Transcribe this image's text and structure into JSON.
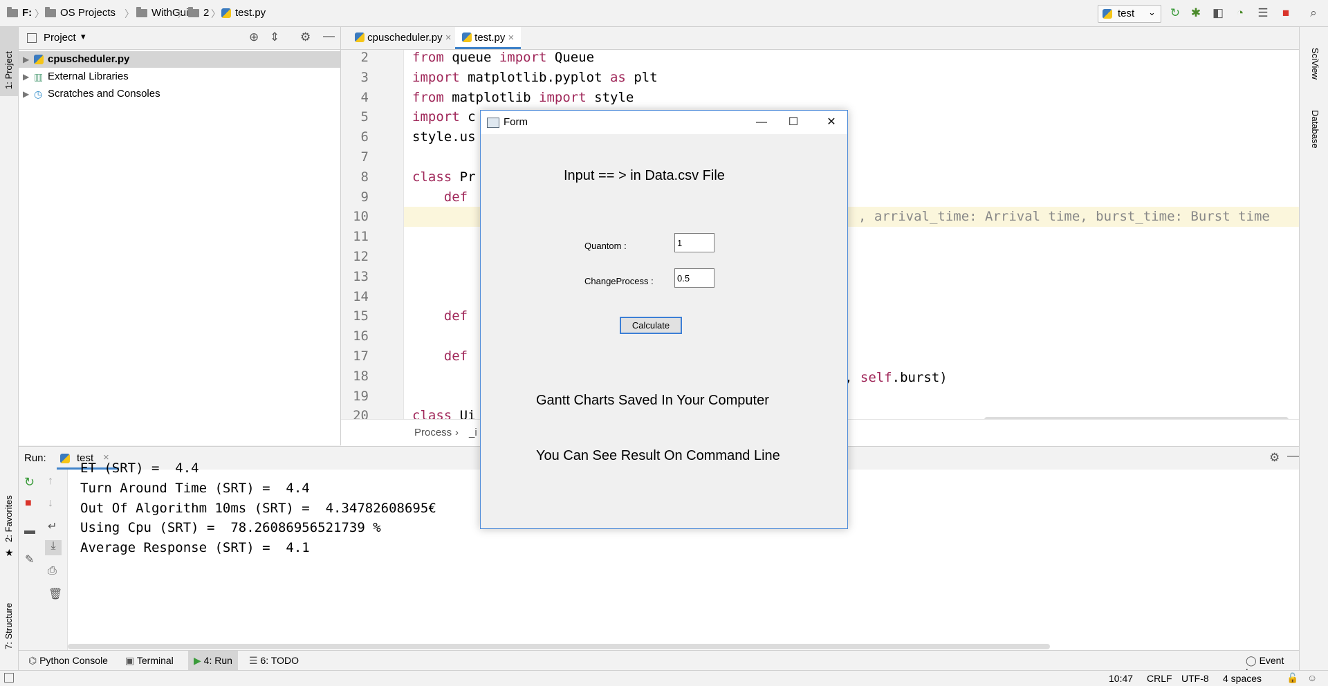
{
  "breadcrumbs": [
    "F:",
    "OS Projects",
    "WithGui",
    "2",
    "test.py"
  ],
  "run_config": "test",
  "left_stripe": {
    "project": "1: Project",
    "favorites": "2: Favorites",
    "structure": "7: Structure"
  },
  "right_stripe": {
    "sciview": "SciView",
    "database": "Database"
  },
  "project_panel": {
    "title": "Project",
    "items": [
      {
        "label": "cpuscheduler.py"
      },
      {
        "label": "External Libraries"
      },
      {
        "label": "Scratches and Consoles"
      }
    ]
  },
  "editor_tabs": [
    {
      "label": "cpuscheduler.py"
    },
    {
      "label": "test.py"
    }
  ],
  "editor": {
    "lines": [
      {
        "n": "2",
        "pre": "",
        "kw": "from",
        "rest": " queue ",
        "kw2": "import",
        "rest2": " Queue"
      },
      {
        "n": "3",
        "pre": "",
        "kw": "import",
        "rest": " matplotlib.pyplot ",
        "kw2": "as",
        "rest2": " plt"
      },
      {
        "n": "4",
        "pre": "",
        "kw": "from",
        "rest": " matplotlib ",
        "kw2": "import",
        "rest2": " style"
      },
      {
        "n": "5",
        "pre": "",
        "kw": "import",
        "rest": " c",
        "kw2": "",
        "rest2": ""
      },
      {
        "n": "6",
        "pre": "style.us",
        "kw": "",
        "rest": "",
        "kw2": "",
        "rest2": ""
      },
      {
        "n": "7",
        "pre": "",
        "kw": "",
        "rest": "",
        "kw2": "",
        "rest2": ""
      },
      {
        "n": "8",
        "pre": "",
        "kw": "class",
        "rest": " Pr",
        "kw2": "",
        "rest2": ""
      },
      {
        "n": "9",
        "pre": "    ",
        "kw": "def",
        "rest": "",
        "kw2": "",
        "rest2": ""
      },
      {
        "n": "10",
        "pre": "",
        "kw": "",
        "rest": "",
        "kw2": "",
        "rest2": ""
      },
      {
        "n": "11",
        "pre": "",
        "kw": "",
        "rest": "",
        "kw2": "",
        "rest2": ""
      },
      {
        "n": "12",
        "pre": "",
        "kw": "",
        "rest": "",
        "kw2": "",
        "rest2": ""
      },
      {
        "n": "13",
        "pre": "",
        "kw": "",
        "rest": "",
        "kw2": "",
        "rest2": ""
      },
      {
        "n": "14",
        "pre": "",
        "kw": "",
        "rest": "",
        "kw2": "",
        "rest2": ""
      },
      {
        "n": "15",
        "pre": "    ",
        "kw": "def",
        "rest": "",
        "kw2": "",
        "rest2": ""
      },
      {
        "n": "16",
        "pre": "",
        "kw": "",
        "rest": "",
        "kw2": "",
        "rest2": ""
      },
      {
        "n": "17",
        "pre": "    ",
        "kw": "def",
        "rest": "",
        "kw2": "",
        "rest2": ""
      },
      {
        "n": "18",
        "pre": "",
        "kw": "",
        "rest": "",
        "kw2": "",
        "rest2": ""
      },
      {
        "n": "19",
        "pre": "",
        "kw": "",
        "rest": "",
        "kw2": "",
        "rest2": ""
      },
      {
        "n": "20",
        "pre": "",
        "kw": "class",
        "rest": " Ui",
        "kw2": "",
        "rest2": ""
      }
    ],
    "line10_tail": ", arrival_time: Arrival time, burst_time: Burst time",
    "line18_tail_a": ", ",
    "line18_tail_kw": "self",
    "line18_tail_b": ".burst)",
    "breadcrumb": [
      "Process",
      "_i"
    ]
  },
  "run_panel": {
    "label": "Run:",
    "tab": "test",
    "output": [
      "ET (SRT) =  4.4",
      "Turn Around Time (SRT) =  4.4",
      "Out Of Algorithm 10ms (SRT) =  4.34782608695€",
      "Using Cpu (SRT) =  78.26086956521739 %",
      "Average Response (SRT) =  4.1"
    ]
  },
  "bottom_tools": [
    "Python Console",
    "Terminal",
    "4: Run",
    "6: TODO",
    "Event Log"
  ],
  "status": {
    "time": "10:47",
    "line_sep": "CRLF",
    "encoding": "UTF-8",
    "indent": "4 spaces"
  },
  "form": {
    "title": "Form",
    "heading": "Input == > in Data.csv File",
    "quantom_label": "Quantom :",
    "quantom_value": "1",
    "change_label": "ChangeProcess :",
    "change_value": "0.5",
    "calculate": "Calculate",
    "msg1": "Gantt Charts Saved In Your Computer",
    "msg2": "You Can See Result On Command Line"
  }
}
